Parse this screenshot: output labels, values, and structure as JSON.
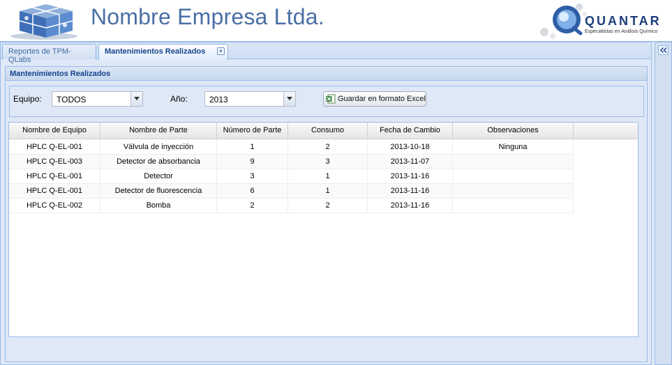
{
  "header": {
    "company_title": "Nombre Empresa Ltda.",
    "brand_name": "QUANTAR",
    "brand_tagline": "Especialistas en Análisis Químico"
  },
  "tabs": [
    {
      "label": "Reportes de TPM-QLabs",
      "active": false
    },
    {
      "label": "Mantenimientos Realizados",
      "active": true
    }
  ],
  "panel": {
    "title": "Mantenimientos Realizados"
  },
  "filters": {
    "equipo_label": "Equipo:",
    "equipo_value": "TODOS",
    "anio_label": "Año:",
    "anio_value": "2013",
    "export_button": "Guardar en formato Excel"
  },
  "grid": {
    "columns": [
      "Nombre de Equipo",
      "Nombre de Parte",
      "Número de Parte",
      "Consumo",
      "Fecha de Cambio",
      "Observaciones"
    ],
    "rows": [
      [
        "HPLC Q-EL-001",
        "Válvula de inyección",
        "1",
        "2",
        "2013-10-18",
        "Ninguna"
      ],
      [
        "HPLC Q-EL-003",
        "Detector de absorbancia",
        "9",
        "3",
        "2013-11-07",
        ""
      ],
      [
        "HPLC Q-EL-001",
        "Detector",
        "3",
        "1",
        "2013-11-16",
        ""
      ],
      [
        "HPLC Q-EL-001",
        "Detector de fluorescencia",
        "6",
        "1",
        "2013-11-16",
        ""
      ],
      [
        "HPLC Q-EL-002",
        "Bomba",
        "2",
        "2",
        "2013-11-16",
        ""
      ]
    ]
  },
  "colors": {
    "accent": "#15428b",
    "panel_border": "#99bbe8",
    "panel_bg": "#dfe8f6",
    "title_blue": "#4a6fa5"
  },
  "icons": {
    "logo": "cube-logo-icon",
    "brand": "quantar-globe-icon",
    "close": "close-icon",
    "dropdown": "chevron-down-icon",
    "excel": "excel-icon",
    "expand": "double-chevron-left-icon"
  }
}
